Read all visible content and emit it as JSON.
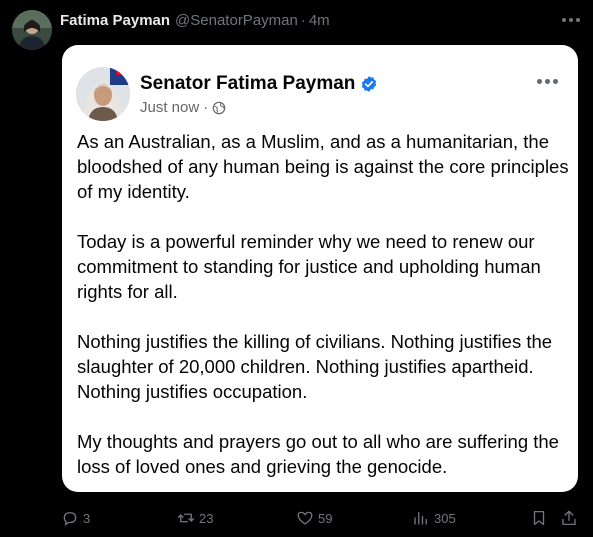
{
  "tweet": {
    "author_name": "Fatima Payman",
    "handle": "@SenatorPayman",
    "separator": "·",
    "time": "4m"
  },
  "embedded_post": {
    "author_name": "Senator Fatima Payman",
    "timestamp": "Just now",
    "separator": "·",
    "paragraphs": [
      "As an Australian, as a Muslim, and as a humanitarian, the bloodshed of any human being  is against the core principles of my identity.",
      "Today is a powerful reminder why we need to renew our commitment to standing for justice and upholding human rights for all.",
      "Nothing justifies the killing of civilians. Nothing justifies the slaughter of 20,000 children. Nothing justifies apartheid. Nothing justifies occupation.",
      "My thoughts and prayers go out to all who are suffering the loss of loved ones and grieving the genocide."
    ]
  },
  "actions": {
    "replies": "3",
    "reposts": "23",
    "likes": "59",
    "views": "305"
  },
  "icons": {
    "reply": "reply-icon",
    "repost": "repost-icon",
    "like": "heart-icon",
    "views": "views-icon",
    "bookmark": "bookmark-icon",
    "share": "share-icon",
    "more": "more-icon",
    "verified": "verified-badge-icon",
    "audience": "globe-icon"
  },
  "colors": {
    "background": "#000000",
    "primary_text": "#e7e9ea",
    "secondary_text": "#71767b",
    "card_background": "#ffffff",
    "verified_blue": "#1877f2"
  }
}
